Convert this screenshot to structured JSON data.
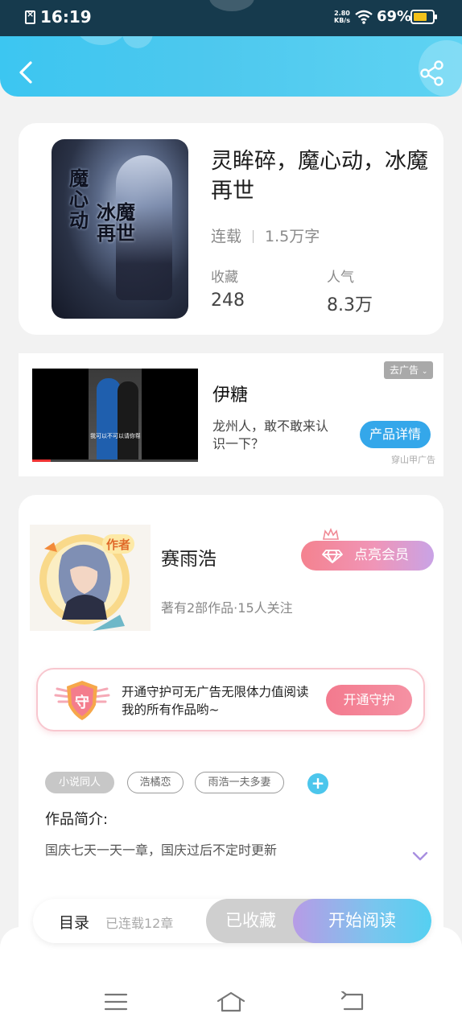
{
  "status_bar": {
    "time": "16:19",
    "net_speed_value": "2.80",
    "net_speed_unit": "KB/s",
    "battery_percent": "69%",
    "battery_color": "#f4c21b"
  },
  "header": {
    "back_icon": "chevron-left-icon",
    "share_icon": "share-icon",
    "accent": "#3cc6f1"
  },
  "book": {
    "cover_title_1": "魔心动",
    "cover_title_2": "冰魔再世",
    "title": "灵眸碎，魔心动，冰魔再世",
    "status": "连载",
    "word_count": "1.5万字",
    "stats": [
      {
        "label": "收藏",
        "value": "248"
      },
      {
        "label": "人气",
        "value": "8.3万"
      }
    ]
  },
  "ad": {
    "close_label": "去广告",
    "name": "伊糖",
    "description": "龙州人，敢不敢来认识一下？",
    "button_label": "产品详情",
    "source": "穿山甲广告",
    "video_subtitle": "我可以不可以请你帮我",
    "video_progress": 0.11
  },
  "author": {
    "badge": "作者",
    "name": "赛雨浩",
    "info": "著有2部作品·15人关注",
    "vip_button": "点亮会员",
    "guard_icon_text": "守",
    "guard_text": "开通守护可无广告无限体力值阅读我的所有作品哟~",
    "guard_button": "开通守护",
    "tags": [
      "小说同人",
      "浩橘恋",
      "雨浩一夫多妻"
    ],
    "intro_label": "作品简介:",
    "intro_text": "国庆七天一天一章，国庆过后不定时更新"
  },
  "action_bar": {
    "toc_label": "目录",
    "toc_count": "已连载12章",
    "collected_label": "已收藏",
    "read_label": "开始阅读"
  },
  "nav": {
    "menu_icon": "menu-icon",
    "home_icon": "home-icon",
    "back_icon": "back-icon"
  }
}
